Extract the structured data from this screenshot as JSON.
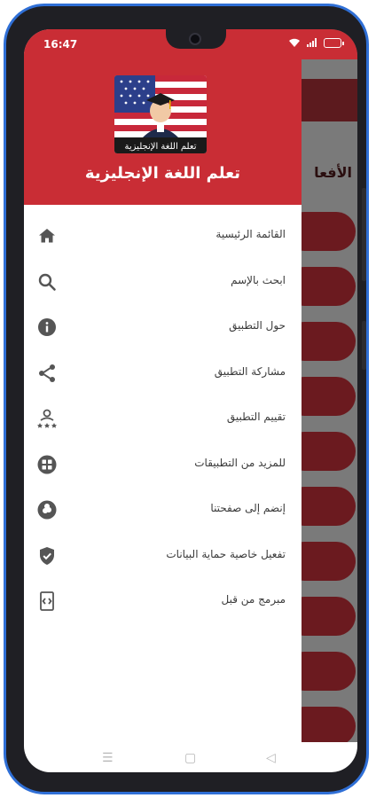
{
  "status_bar": {
    "time": "16:47"
  },
  "drawer": {
    "logo_caption": "تعلم اللغة الإنجليزية",
    "title": "تعلم اللغة الإنجليزية",
    "items": [
      {
        "label": "القائمة الرئيسية",
        "icon": "home-icon"
      },
      {
        "label": "ابحث بالإسم",
        "icon": "search-icon"
      },
      {
        "label": "حول التطبيق",
        "icon": "info-icon"
      },
      {
        "label": "مشاركة التطبيق",
        "icon": "share-icon"
      },
      {
        "label": "تقييم التطبيق",
        "icon": "rate-icon"
      },
      {
        "label": "للمزيد من التطبيقات",
        "icon": "apps-icon"
      },
      {
        "label": "إنضم إلى صفحتنا",
        "icon": "join-page-icon"
      },
      {
        "label": "تفعيل خاصية حماية البيانات",
        "icon": "shield-icon"
      },
      {
        "label": "مبرمج من قبل",
        "icon": "developer-icon"
      }
    ]
  },
  "background_app": {
    "visible_fragment": "الأفعا"
  },
  "colors": {
    "primary_red": "#c92d35",
    "icon_gray": "#555555"
  }
}
